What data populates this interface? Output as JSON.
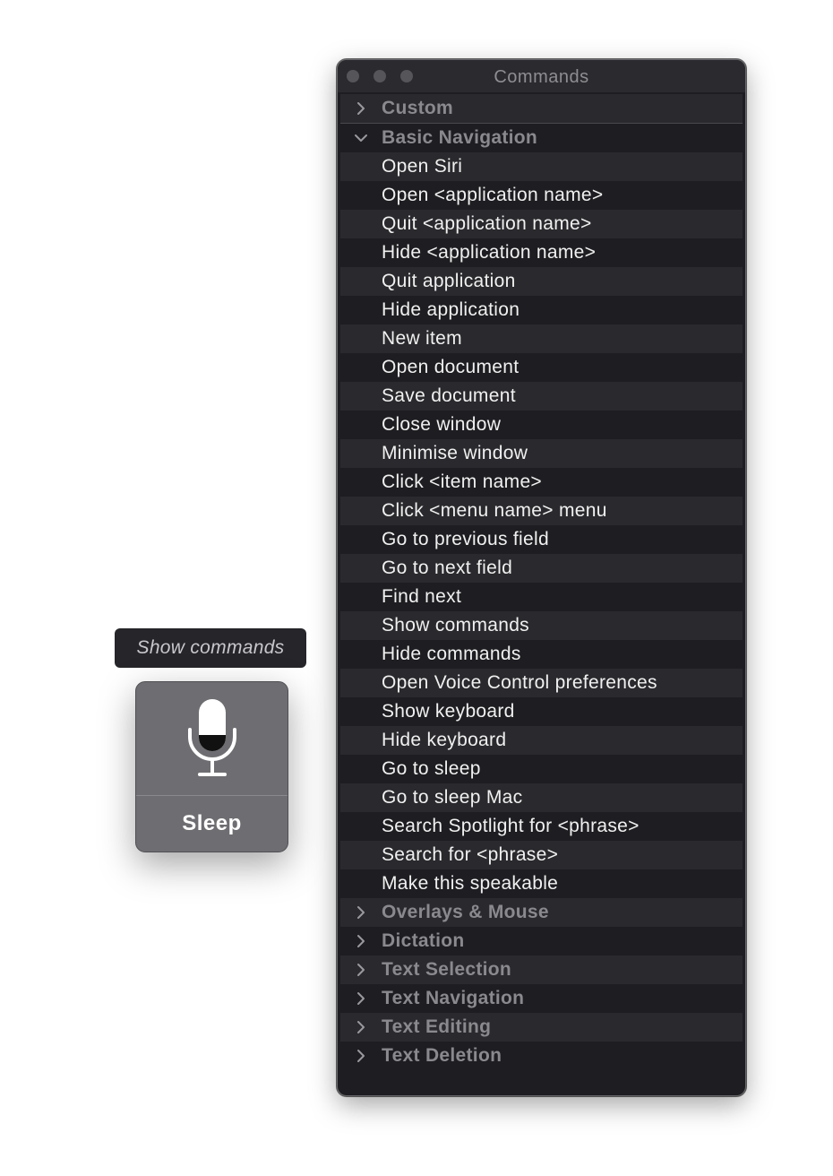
{
  "window": {
    "title": "Commands",
    "rows": [
      {
        "type": "group",
        "label": "Custom",
        "expanded": false
      },
      {
        "type": "group",
        "label": "Basic Navigation",
        "expanded": true
      },
      {
        "type": "item",
        "label": "Open Siri"
      },
      {
        "type": "item",
        "label": "Open <application name>"
      },
      {
        "type": "item",
        "label": "Quit <application name>"
      },
      {
        "type": "item",
        "label": "Hide <application name>"
      },
      {
        "type": "item",
        "label": "Quit application"
      },
      {
        "type": "item",
        "label": "Hide application"
      },
      {
        "type": "item",
        "label": "New item"
      },
      {
        "type": "item",
        "label": "Open document"
      },
      {
        "type": "item",
        "label": "Save document"
      },
      {
        "type": "item",
        "label": "Close window"
      },
      {
        "type": "item",
        "label": "Minimise window"
      },
      {
        "type": "item",
        "label": "Click <item name>"
      },
      {
        "type": "item",
        "label": "Click <menu name> menu"
      },
      {
        "type": "item",
        "label": "Go to previous field"
      },
      {
        "type": "item",
        "label": "Go to next field"
      },
      {
        "type": "item",
        "label": "Find next"
      },
      {
        "type": "item",
        "label": "Show commands"
      },
      {
        "type": "item",
        "label": "Hide commands"
      },
      {
        "type": "item",
        "label": "Open Voice Control preferences"
      },
      {
        "type": "item",
        "label": "Show keyboard"
      },
      {
        "type": "item",
        "label": "Hide keyboard"
      },
      {
        "type": "item",
        "label": "Go to sleep"
      },
      {
        "type": "item",
        "label": "Go to sleep Mac"
      },
      {
        "type": "item",
        "label": "Search Spotlight for <phrase>"
      },
      {
        "type": "item",
        "label": "Search for <phrase>"
      },
      {
        "type": "item",
        "label": "Make this speakable"
      },
      {
        "type": "group",
        "label": "Overlays & Mouse",
        "expanded": false
      },
      {
        "type": "group",
        "label": "Dictation",
        "expanded": false
      },
      {
        "type": "group",
        "label": "Text Selection",
        "expanded": false
      },
      {
        "type": "group",
        "label": "Text Navigation",
        "expanded": false
      },
      {
        "type": "group",
        "label": "Text Editing",
        "expanded": false
      },
      {
        "type": "group",
        "label": "Text Deletion",
        "expanded": false
      }
    ]
  },
  "tooltip": {
    "text": "Show commands"
  },
  "mic": {
    "icon": "microphone-icon",
    "status": "Sleep"
  },
  "colors": {
    "window_bg": "#1e1e22",
    "row_alt": "#2a2a2e",
    "group_text": "#8a8a8e",
    "item_text": "#f0f0f0"
  }
}
